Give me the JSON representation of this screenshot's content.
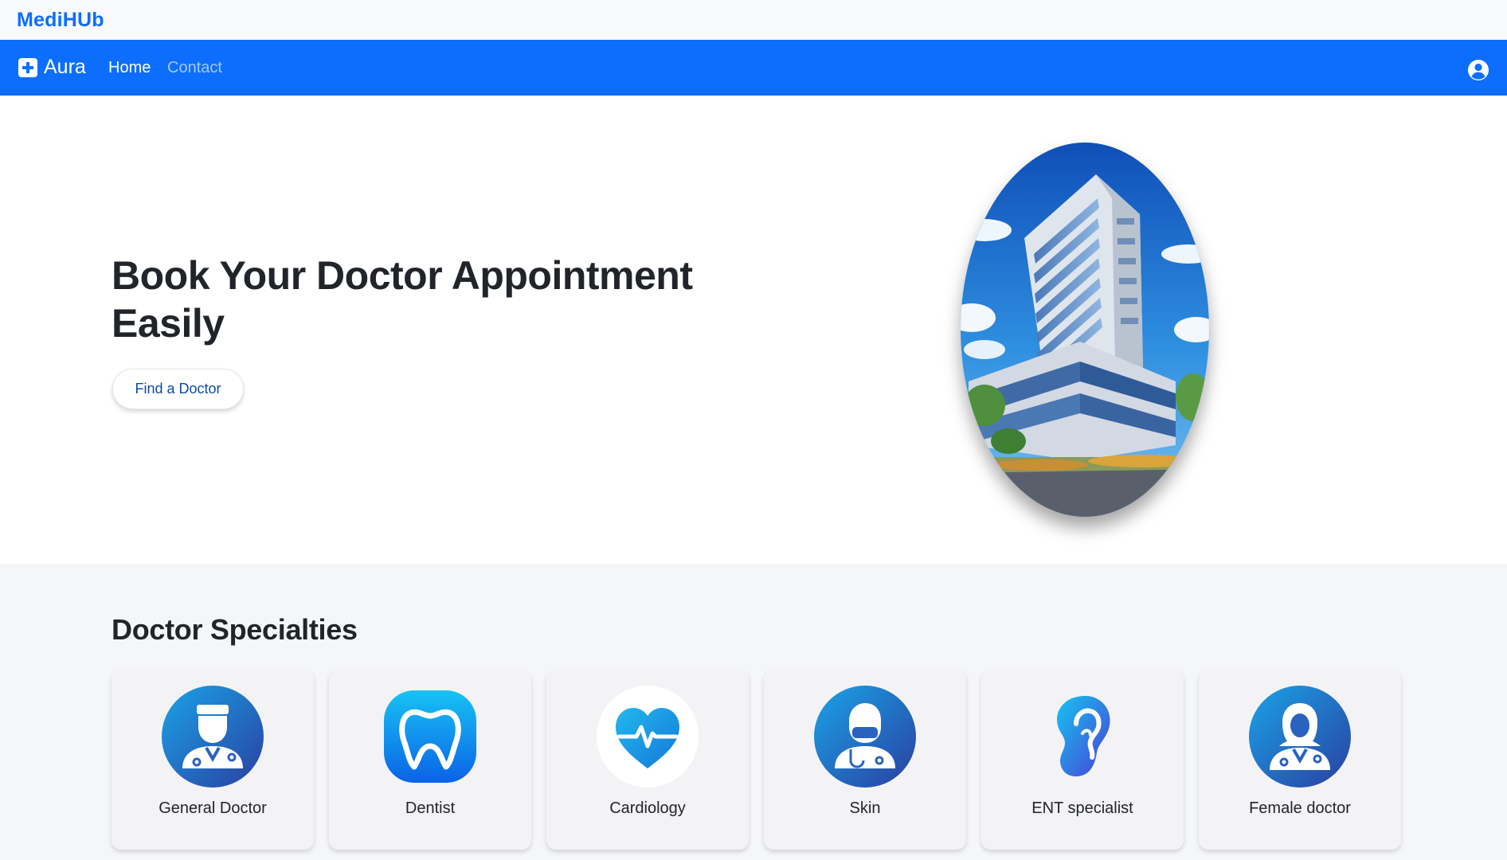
{
  "topbar": {
    "brand": "MediHUb"
  },
  "navbar": {
    "brand": "Aura",
    "links": [
      {
        "label": "Home",
        "active": true
      },
      {
        "label": "Contact",
        "active": false
      }
    ],
    "user_icon": "user-circle-icon"
  },
  "hero": {
    "title": "Book Your Doctor Appointment Easily",
    "button_label": "Find a Doctor",
    "image": "hospital-building-illustration"
  },
  "specialties": {
    "title": "Doctor Specialties",
    "items": [
      {
        "label": "General Doctor",
        "icon": "male-doctor-icon"
      },
      {
        "label": "Dentist",
        "icon": "tooth-icon"
      },
      {
        "label": "Cardiology",
        "icon": "heart-pulse-icon"
      },
      {
        "label": "Skin",
        "icon": "doctor-mask-icon"
      },
      {
        "label": "ENT specialist",
        "icon": "ear-icon"
      },
      {
        "label": "Female doctor",
        "icon": "female-doctor-icon"
      }
    ]
  },
  "colors": {
    "primary": "#0d6efd",
    "topbar_bg": "#f8f9fa",
    "section_bg": "#f5f6f8",
    "icon_gradient_start": "#1aa3e8",
    "icon_gradient_end": "#2a3fa0"
  }
}
